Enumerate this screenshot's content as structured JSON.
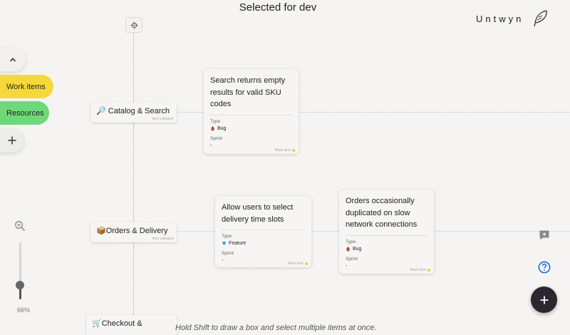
{
  "header": {
    "title": "Selected for dev",
    "brand": "Untwyn"
  },
  "nav": {
    "work_items": "Work items",
    "resources": "Resources"
  },
  "zoom": {
    "label": "66%",
    "level_percent": 66
  },
  "lanes": [
    {
      "category": "🔎 Catalog & Search",
      "category_sub": "Item category"
    },
    {
      "category": "📦Orders & Delivery",
      "category_sub": "Item category"
    },
    {
      "category": "🛒Checkout &",
      "category_sub": ""
    }
  ],
  "cards": [
    {
      "title": "Search returns empty results for valid SKU codes",
      "type_label": "Type",
      "type_value": "Bug",
      "type_icon": "bug-icon",
      "sprint_label": "Sprint",
      "sprint_value": "-",
      "footer": "Work item"
    },
    {
      "title": "Allow users to select delivery time slots",
      "type_label": "Type",
      "type_value": "Feature",
      "type_icon": "gem-icon",
      "sprint_label": "Sprint",
      "sprint_value": "-",
      "footer": "Work item"
    },
    {
      "title": "Orders occasionally duplicated on slow network connections",
      "type_label": "Type",
      "type_value": "Bug",
      "type_icon": "bug-icon",
      "sprint_label": "Sprint",
      "sprint_value": "-",
      "footer": "Work item"
    }
  ],
  "hint": "Hold Shift to draw a box and select multiple items at once.",
  "colors": {
    "work_items_pill": "#f5d93a",
    "resources_pill": "#6fd979",
    "fab": "#2a2730",
    "help_icon": "#1e6fd6",
    "lane_line": "#cfe0ee"
  }
}
